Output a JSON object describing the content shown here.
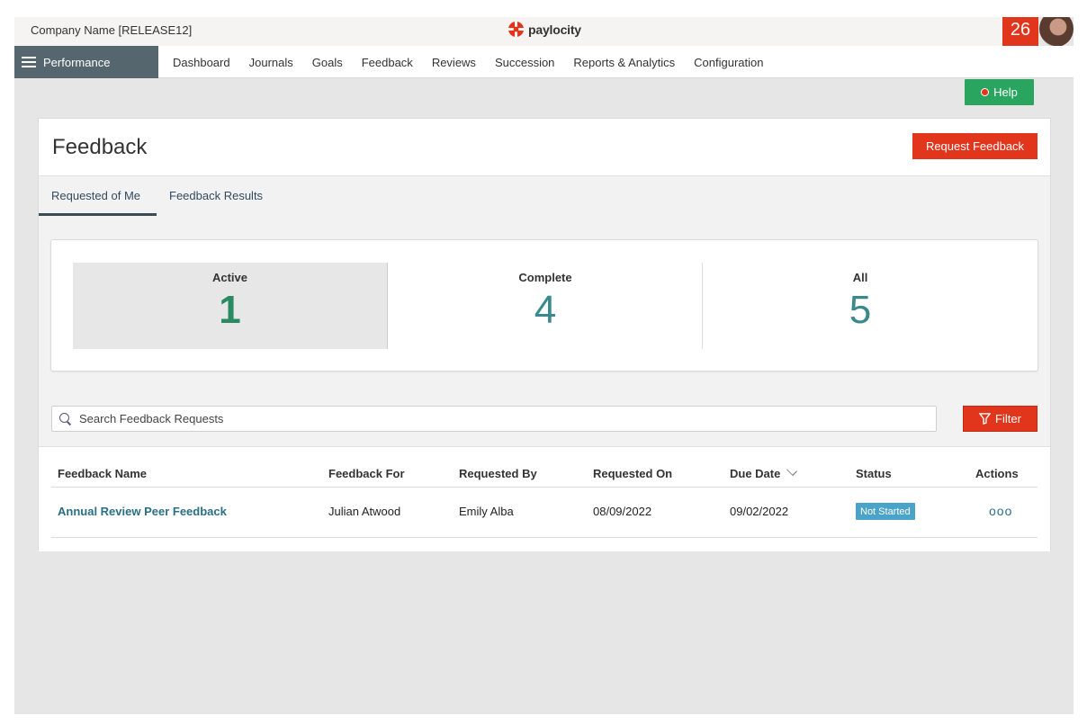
{
  "header": {
    "company": "Company Name [RELEASE12]",
    "logo_text": "paylocity",
    "notification_count": "26"
  },
  "nav": {
    "module": "Performance",
    "items": [
      "Dashboard",
      "Journals",
      "Goals",
      "Feedback",
      "Reviews",
      "Succession",
      "Reports & Analytics",
      "Configuration"
    ]
  },
  "help_label": "Help",
  "page": {
    "title": "Feedback",
    "request_button": "Request Feedback",
    "tabs": [
      "Requested of Me",
      "Feedback Results"
    ],
    "stats": [
      {
        "label": "Active",
        "value": "1"
      },
      {
        "label": "Complete",
        "value": "4"
      },
      {
        "label": "All",
        "value": "5"
      }
    ],
    "search_placeholder": "Search Feedback Requests",
    "filter_label": "Filter"
  },
  "table": {
    "headers": [
      "Feedback Name",
      "Feedback For",
      "Requested By",
      "Requested On",
      "Due Date",
      "Status",
      "Actions"
    ],
    "rows": [
      {
        "name": "Annual Review Peer Feedback",
        "for": "Julian Atwood",
        "by": "Emily Alba",
        "requested_on": "08/09/2022",
        "due": "09/02/2022",
        "status": "Not Started",
        "actions": "ooo"
      }
    ]
  },
  "colors": {
    "accent_red": "#e2361c",
    "help_green": "#2aa55f",
    "module_gray": "#56666e",
    "link_teal": "#2a6f84",
    "status_blue": "#4aa3c8"
  }
}
